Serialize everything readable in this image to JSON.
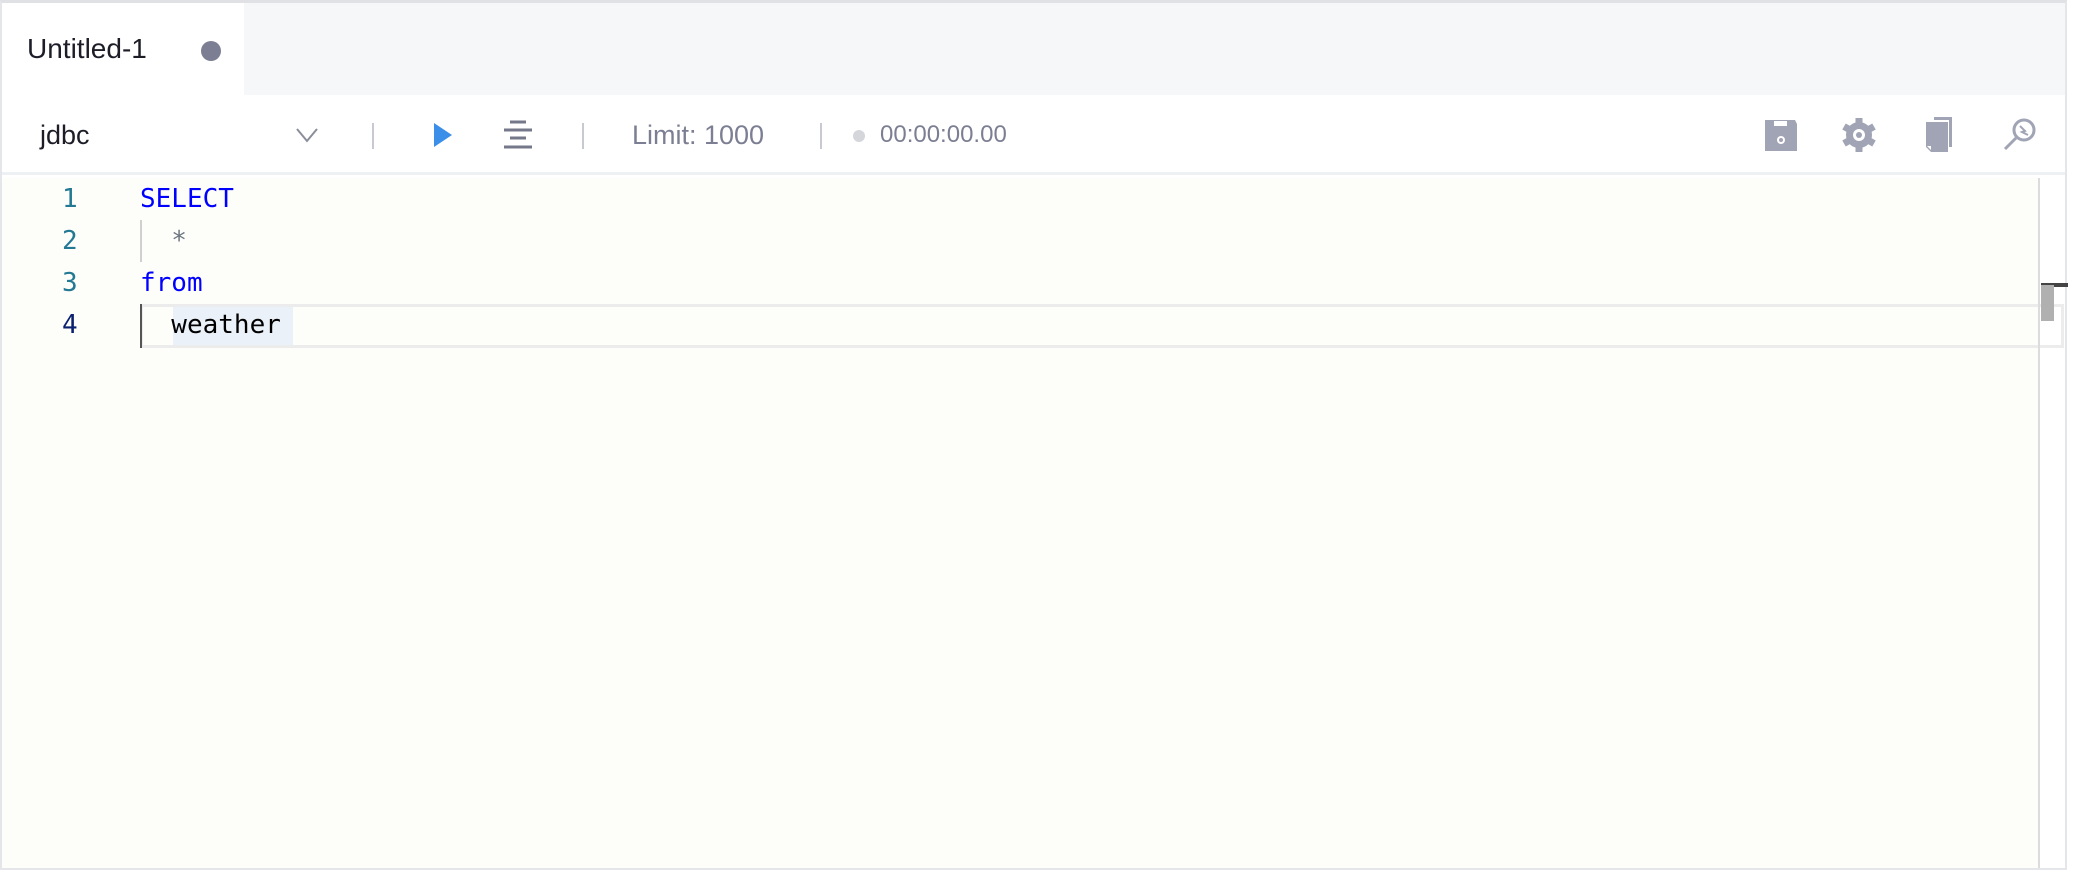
{
  "tabs": [
    {
      "label": "Untitled-1",
      "modified": true
    }
  ],
  "toolbar": {
    "datasource": "jdbc",
    "limit_label": "Limit: 1000",
    "elapsed": "00:00:00.00",
    "run_color": "#3b8fe8",
    "icons": [
      "chevron-down-icon",
      "play-icon",
      "format-icon",
      "save-icon",
      "gear-icon",
      "copy-icon",
      "explain-search-icon"
    ]
  },
  "editor": {
    "lines": [
      {
        "number": "1",
        "text": "SELECT",
        "keyword": true
      },
      {
        "number": "2",
        "text": "  *",
        "keyword": false
      },
      {
        "number": "3",
        "text": "from",
        "keyword": true
      },
      {
        "number": "4",
        "text": "  weather",
        "keyword": false
      }
    ],
    "current_line": 4,
    "keyword_color": "#0000ff"
  }
}
